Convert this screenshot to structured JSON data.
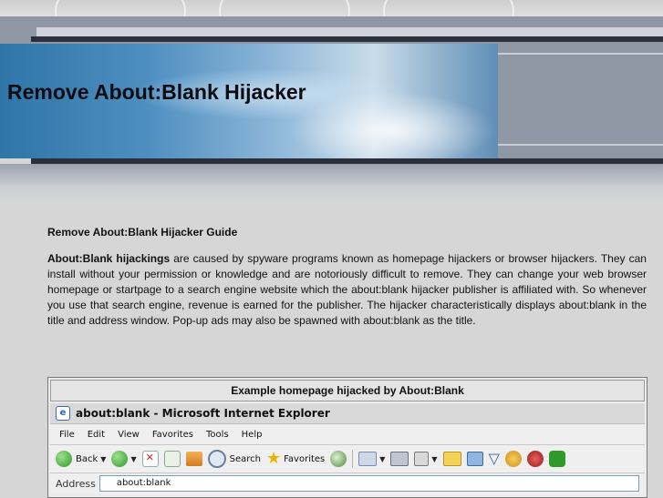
{
  "banner": {
    "title": "Remove About:Blank Hijacker"
  },
  "article": {
    "heading": "Remove About:Blank Hijacker Guide",
    "intro_bold": "About:Blank hijackings",
    "intro_text": " are caused by spyware programs known as homepage hijackers or browser hijackers. They can install without your permission or knowledge and are notoriously difficult to remove. They can change your web browser homepage or startpage to a search engine website which the about:blank hijacker publisher is affiliated with. So whenever you use that search engine, revenue is earned for the publisher. The hijacker characteristically displays about:blank in the title and address window. Pop-up ads may also be spawned with about:blank as the title."
  },
  "example": {
    "caption": "Example homepage hijacked by About:Blank",
    "window_title": "about:blank - Microsoft Internet Explorer",
    "menu": [
      "File",
      "Edit",
      "View",
      "Favorites",
      "Tools",
      "Help"
    ],
    "toolbar": {
      "back": "Back",
      "search": "Search",
      "favorites": "Favorites"
    },
    "address_label": "Address",
    "address_value": "about:blank"
  },
  "colors": {
    "page_bg": "#d6d6d6",
    "banner_dark": "#2b2f3b",
    "banner_blue": "#4e8fc0"
  }
}
